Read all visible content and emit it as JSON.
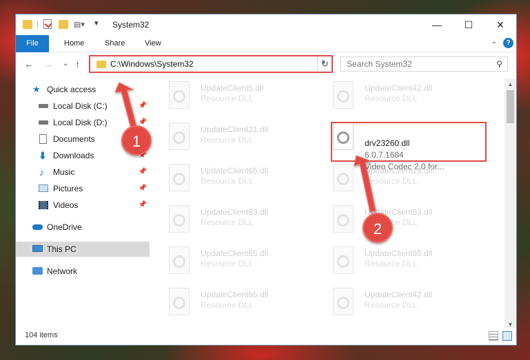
{
  "window": {
    "title": "System32",
    "controls": {
      "minimize": "—",
      "maximize": "☐",
      "close": "✕"
    }
  },
  "ribbon": {
    "tabs": [
      {
        "label": "File"
      },
      {
        "label": "Home"
      },
      {
        "label": "Share"
      },
      {
        "label": "View"
      }
    ],
    "help": "?"
  },
  "nav": {
    "address": "C:\\Windows\\System32",
    "search_placeholder": "Search System32"
  },
  "sidebar": {
    "items": [
      {
        "label": "Quick access",
        "icon": "star-icon",
        "pinned": false
      },
      {
        "label": "Local Disk (C:)",
        "icon": "drive-icon",
        "pinned": true
      },
      {
        "label": "Local Disk (D:)",
        "icon": "drive-icon",
        "pinned": true
      },
      {
        "label": "Documents",
        "icon": "documents-icon",
        "pinned": true
      },
      {
        "label": "Downloads",
        "icon": "download-icon",
        "pinned": true
      },
      {
        "label": "Music",
        "icon": "music-icon",
        "pinned": true
      },
      {
        "label": "Pictures",
        "icon": "pictures-icon",
        "pinned": true
      },
      {
        "label": "Videos",
        "icon": "videos-icon",
        "pinned": true
      },
      {
        "label": "OneDrive",
        "icon": "cloud-icon",
        "pinned": false
      },
      {
        "label": "This PC",
        "icon": "computer-icon",
        "pinned": false,
        "selected": true
      },
      {
        "label": "Network",
        "icon": "network-icon",
        "pinned": false
      }
    ]
  },
  "files": {
    "left": [
      {
        "name": "UpdateClient5.dll",
        "desc": "Resource DLL"
      },
      {
        "name": "UpdateClient21.dll",
        "desc": "Resource DLL"
      },
      {
        "name": "UpdateClient65.dll",
        "desc": "Resource DLL"
      },
      {
        "name": "UpdateClient63.dll",
        "desc": "Resource DLL"
      },
      {
        "name": "UpdateClient65.dll",
        "desc": "Resource DLL"
      },
      {
        "name": "UpdateClient65.dll",
        "desc": "Resource DLL"
      }
    ],
    "right": [
      {
        "name": "UpdateClient42.dll",
        "desc": "Resource DLL"
      },
      {
        "name": "drv23260.dll",
        "version": "6.0.7.1684",
        "desc": "Video Codec 2.0 for...",
        "highlighted": true
      },
      {
        "name": "UpdateClient19.dll",
        "desc": "Resource DLL"
      },
      {
        "name": "UpdateClient63.dll",
        "desc": "Resource DLL"
      },
      {
        "name": "UpdateClient65.dll",
        "desc": "Resource DLL"
      },
      {
        "name": "UpdateClient42.dll",
        "desc": "Resource DLL"
      }
    ]
  },
  "status": {
    "count": "104 items"
  },
  "callouts": [
    {
      "number": "1"
    },
    {
      "number": "2"
    }
  ],
  "colors": {
    "accent": "#1979ca",
    "callout": "#e34a43",
    "folder": "#f0c54a"
  }
}
